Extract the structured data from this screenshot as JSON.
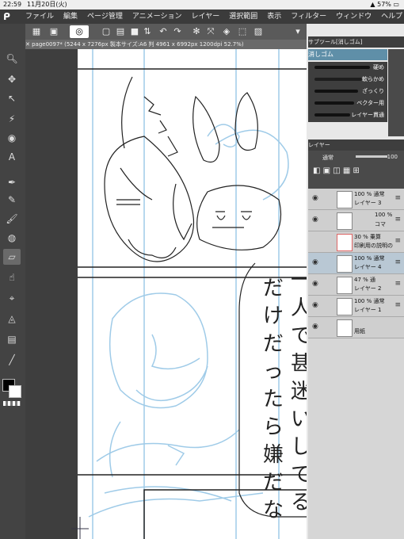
{
  "status": {
    "time": "22:59",
    "date": "11月20日(火)",
    "battery": "57%"
  },
  "menu": {
    "items": [
      "ファイル",
      "編集",
      "ページ管理",
      "アニメーション",
      "レイヤー",
      "選択範囲",
      "表示",
      "フィルター",
      "ウィンドウ",
      "ヘルプ"
    ]
  },
  "canvas": {
    "tab_title": "page0097* (5244 x 7276px 製本サイズ:A6 判 4961 x 6992px 1200dpi 52.7%)"
  },
  "subtool": {
    "header": "サブツール[消しゴム]",
    "selected": "消しゴム",
    "items": [
      {
        "label": "硬め"
      },
      {
        "label": "軟らかめ"
      },
      {
        "label": "ざっくり"
      },
      {
        "label": "ベクター用"
      },
      {
        "label": "レイヤー貫通"
      }
    ]
  },
  "layers": {
    "header": "レイヤー",
    "blend_mode": "通常",
    "opacity": "100",
    "items": [
      {
        "line1": "100 % 通常",
        "line2": "レイヤー 3"
      },
      {
        "line1": "100 %",
        "line2": "コマ"
      },
      {
        "line1": "30 % 乗算",
        "line2": "印刷用の説明の"
      },
      {
        "line1": "100 % 通常",
        "line2": "レイヤー 4"
      },
      {
        "line1": "47 % 通",
        "line2": "レイヤー 2"
      },
      {
        "line1": "100 % 通常",
        "line2": "レイヤー 1"
      },
      {
        "line1": "",
        "line2": "用紙"
      }
    ]
  },
  "colors": {
    "menubar": "#3b3b3b",
    "selection_accent": "#5f8fa8",
    "sketch_blue": "#9fcbe8"
  }
}
